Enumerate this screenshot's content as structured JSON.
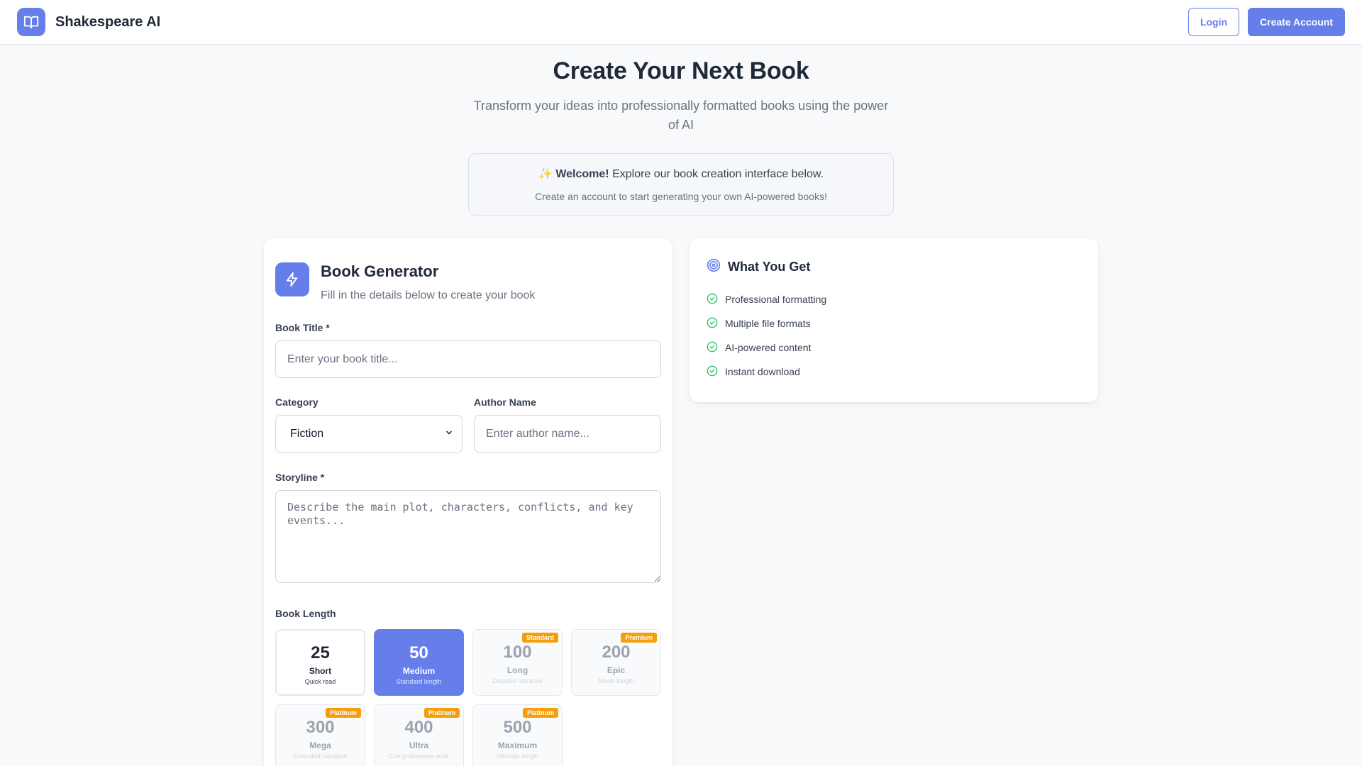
{
  "header": {
    "brand": "Shakespeare AI",
    "login_label": "Login",
    "create_account_label": "Create Account"
  },
  "hero": {
    "title": "Create Your Next Book",
    "subtitle": "Transform your ideas into professionally formatted books using the power of AI"
  },
  "welcome": {
    "emoji": "✨",
    "bold": "Welcome!",
    "text": " Explore our book creation interface below.",
    "note": "Create an account to start generating your own AI-powered books!"
  },
  "generator": {
    "title": "Book Generator",
    "subtitle": "Fill in the details below to create your book",
    "book_title_label": "Book Title *",
    "book_title_placeholder": "Enter your book title...",
    "category_label": "Category",
    "category_value": "Fiction",
    "author_label": "Author Name",
    "author_placeholder": "Enter author name...",
    "storyline_label": "Storyline *",
    "storyline_placeholder": "Describe the main plot, characters, conflicts, and key events...",
    "length_label": "Book Length",
    "lengths": [
      {
        "num": "25",
        "name": "Short",
        "desc": "Quick read",
        "badge": "",
        "state": "available"
      },
      {
        "num": "50",
        "name": "Medium",
        "desc": "Standard length",
        "badge": "",
        "state": "selected"
      },
      {
        "num": "100",
        "name": "Long",
        "desc": "Detailed narrative",
        "badge": "Standard",
        "state": "locked"
      },
      {
        "num": "200",
        "name": "Epic",
        "desc": "Novel-length",
        "badge": "Premium",
        "state": "locked"
      },
      {
        "num": "300",
        "name": "Mega",
        "desc": "Extended narrative",
        "badge": "Platinum",
        "state": "locked"
      },
      {
        "num": "400",
        "name": "Ultra",
        "desc": "Comprehensive work",
        "badge": "Platinum",
        "state": "locked"
      },
      {
        "num": "500",
        "name": "Maximum",
        "desc": "Ultimate length",
        "badge": "Platinum",
        "state": "locked"
      }
    ]
  },
  "what_you_get": {
    "title": "What You Get",
    "items": [
      "Professional formatting",
      "Multiple file formats",
      "AI-powered content",
      "Instant download"
    ]
  },
  "colors": {
    "accent": "#667eea",
    "badge": "#f59e0b",
    "check": "#22c55e"
  }
}
